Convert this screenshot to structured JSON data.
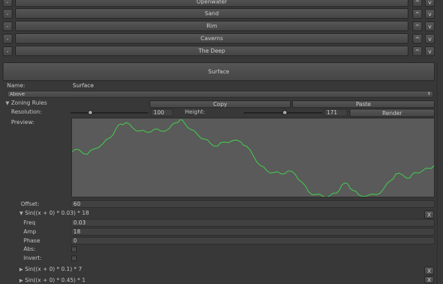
{
  "zones": [
    {
      "name": "Openwater"
    },
    {
      "name": "Sand"
    },
    {
      "name": "Rim"
    },
    {
      "name": "Caverns"
    },
    {
      "name": "The Deep"
    }
  ],
  "zone_controls": {
    "remove": "-",
    "up": "^",
    "down": "v"
  },
  "selected_zone_button": "Surface",
  "name_label": "Name:",
  "name_value": "Surface",
  "above_dropdown": "Above",
  "zoning_rules": {
    "label": "Zoning Rules",
    "copy": "Copy",
    "paste": "Paste",
    "resolution_label": "Resolution:",
    "resolution_value": "100",
    "resolution_fraction": 0.25,
    "height_label": "Height:",
    "height_value": "171",
    "height_fraction": 0.52,
    "render": "Render",
    "preview_label": "Preview:"
  },
  "offset": {
    "label": "Offset:",
    "value": "60"
  },
  "function_1": {
    "title": "Sin((x + 0) * 0.03) * 18",
    "fields": [
      {
        "label": "Freq",
        "value": "0.03"
      },
      {
        "label": "Amp",
        "value": "18"
      },
      {
        "label": "Phase",
        "value": "0"
      }
    ],
    "abs_label": "Abs:",
    "invert_label": "Invert:",
    "remove": "X"
  },
  "function_2": {
    "title": "Sin((x + 0) * 0.1) * 7",
    "remove": "X"
  },
  "function_3": {
    "title": "Sin((x + 0) * 0.45) * 1",
    "remove": "X"
  },
  "colors": {
    "curve": "#3fd94a",
    "preview_bg": "#5a5a5a"
  }
}
